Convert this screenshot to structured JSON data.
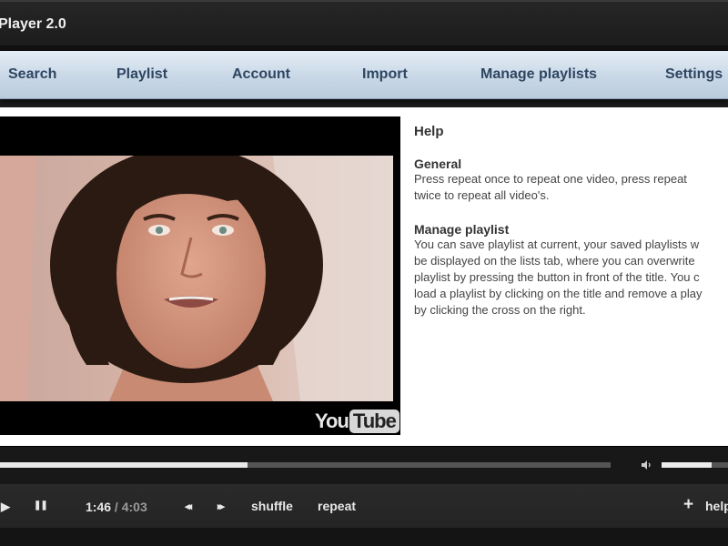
{
  "app": {
    "title": "Player 2.0"
  },
  "nav": {
    "items": [
      {
        "label": "Search"
      },
      {
        "label": "Playlist"
      },
      {
        "label": "Account"
      },
      {
        "label": "Import"
      },
      {
        "label": "Manage playlists"
      },
      {
        "label": "Settings"
      }
    ]
  },
  "video": {
    "logo_you": "You",
    "logo_tube": "Tube"
  },
  "help": {
    "title": "Help",
    "sections": [
      {
        "heading": "General",
        "lines": [
          "Press repeat once to repeat one video, press repeat",
          "twice to repeat all video's."
        ]
      },
      {
        "heading": "Manage playlist",
        "lines": [
          "You can save playlist at current, your saved playlists w",
          "be displayed on the lists tab, where you can overwrite",
          "playlist by pressing the button in front of the title. You c",
          "load a playlist by clicking on the title and remove a play",
          "by clicking the cross on the right."
        ]
      }
    ]
  },
  "player": {
    "current_time": "1:46",
    "separator": " / ",
    "duration": "4:03",
    "progress": 0.405,
    "volume": 0.75,
    "play_icon": "▶",
    "pause_icon": "❚❚",
    "prev_icon": "◂◂",
    "next_icon": "▸▸",
    "shuffle_label": "shuffle",
    "repeat_label": "repeat",
    "add_icon": "+",
    "help_label": "help"
  }
}
